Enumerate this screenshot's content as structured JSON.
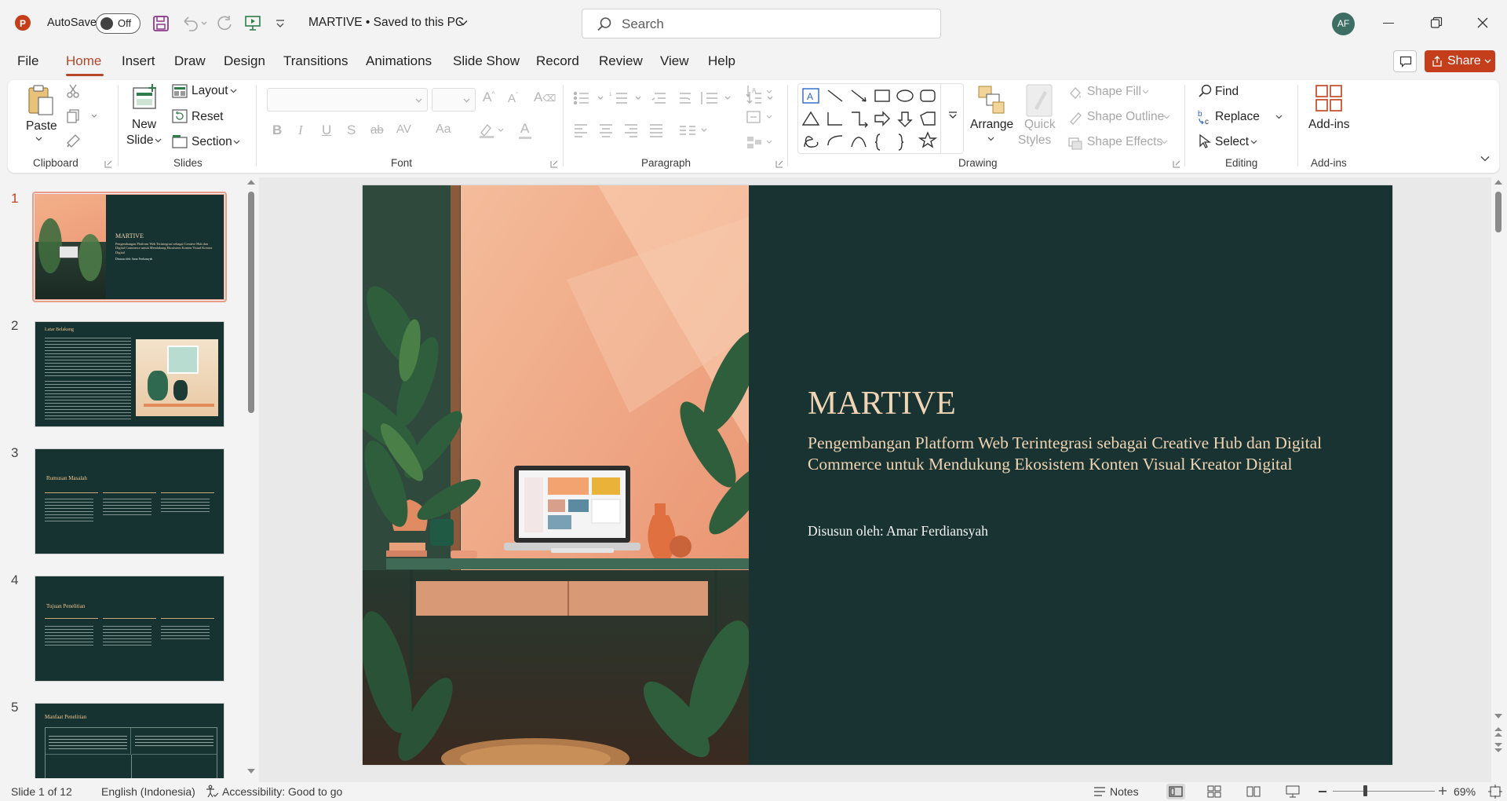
{
  "titlebar": {
    "autosave_label": "AutoSave",
    "autosave_state": "Off",
    "doc_title": "MARTIVE • Saved to this PC",
    "search_placeholder": "Search",
    "user_initials": "AF"
  },
  "tabs": [
    "File",
    "Home",
    "Insert",
    "Draw",
    "Design",
    "Transitions",
    "Animations",
    "Slide Show",
    "Record",
    "Review",
    "View",
    "Help"
  ],
  "active_tab": "Home",
  "share_label": "Share",
  "ribbon": {
    "clipboard": {
      "paste": "Paste",
      "group": "Clipboard"
    },
    "slides": {
      "new_slide_1": "New",
      "new_slide_2": "Slide",
      "layout": "Layout",
      "reset": "Reset",
      "section": "Section",
      "group": "Slides"
    },
    "font": {
      "bold": "B",
      "italic": "I",
      "underline": "U",
      "shadow": "S",
      "strike": "ab",
      "spacing": "AV",
      "case": "Aa",
      "font_color": "A",
      "group": "Font"
    },
    "paragraph": {
      "group": "Paragraph"
    },
    "drawing": {
      "arrange": "Arrange",
      "quick_styles_1": "Quick",
      "quick_styles_2": "Styles",
      "shape_fill": "Shape Fill",
      "shape_outline": "Shape Outline",
      "shape_effects": "Shape Effects",
      "group": "Drawing"
    },
    "editing": {
      "find": "Find",
      "replace": "Replace",
      "select": "Select",
      "group": "Editing"
    },
    "addins": {
      "label": "Add-ins",
      "group": "Add-ins"
    }
  },
  "thumbnails": [
    {
      "num": "1",
      "title": "MARTIVE",
      "sub": "Pengembangan Platform Web Terintegrasi sebagai Creative Hub dan Digital Commerce untuk Mendukung Ekosistem Konten Visual Kreator Digital",
      "author": "Disusun oleh: Amar Ferdiansyah"
    },
    {
      "num": "2",
      "title": "Latar Belakang"
    },
    {
      "num": "3",
      "title": "Rumusan Masalah"
    },
    {
      "num": "4",
      "title": "Tujuan Penelitian"
    },
    {
      "num": "5",
      "title": "Manfaat Penelitian"
    }
  ],
  "slide": {
    "title": "MARTIVE",
    "subtitle": "Pengembangan Platform Web Terintegrasi sebagai Creative Hub dan Digital Commerce untuk Mendukung Ekosistem Konten Visual Kreator Digital",
    "author": "Disusun oleh: Amar Ferdiansyah",
    "bg_color": "#183331",
    "accent_color": "#f0d4b4"
  },
  "status": {
    "slide_count": "Slide 1 of 12",
    "language": "English (Indonesia)",
    "accessibility": "Accessibility: Good to go",
    "notes": "Notes",
    "zoom": "69%"
  },
  "colors": {
    "accent": "#b7472a",
    "ppt_red": "#c43e1c"
  }
}
